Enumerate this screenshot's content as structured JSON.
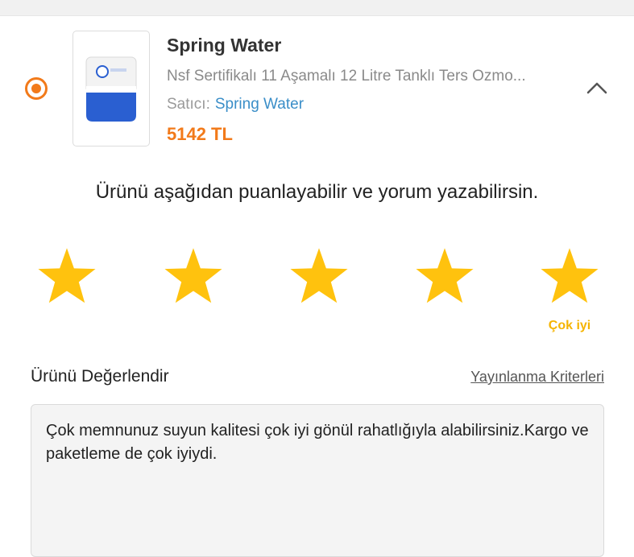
{
  "product": {
    "brand": "Spring Water",
    "name": "Nsf Sertifikalı 11 Aşamalı 12 Litre Tanklı Ters Ozmo...",
    "seller_label": "Satıcı:",
    "seller_name": "Spring Water",
    "price": "5142 TL",
    "selected": true
  },
  "rating": {
    "prompt": "Ürünü aşağıdan puanlayabilir ve yorum yazabilirsin.",
    "max_stars": 5,
    "value": 5,
    "caption": "Çok iyi"
  },
  "review": {
    "section_title": "Ürünü Değerlendir",
    "criteria_link": "Yayınlanma Kriterleri",
    "text": "Çok memnunuz suyun kalitesi çok iyi gönül rahatlığıyla alabilirsiniz.Kargo ve paketleme de çok iyiydi."
  },
  "colors": {
    "accent": "#f27a1a",
    "star": "#ffc20e",
    "link": "#3a8ec8"
  },
  "icons": {
    "radio": "radio-selected-icon",
    "collapse": "chevron-up-icon",
    "star": "star-icon"
  }
}
